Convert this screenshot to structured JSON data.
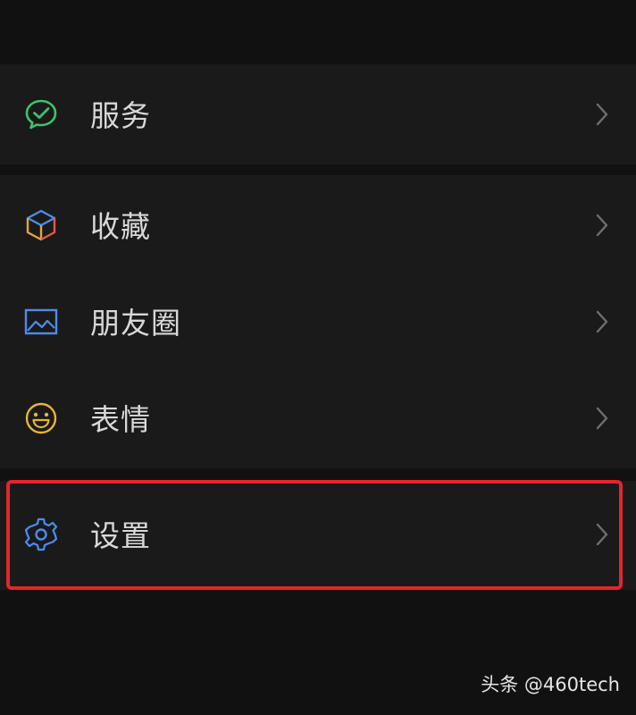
{
  "menu": {
    "items": [
      {
        "label": "服务",
        "icon": "wechat-pay-check-icon",
        "color": "#3cc46a"
      },
      {
        "label": "收藏",
        "icon": "cube-icon",
        "color": "#e8a33c"
      },
      {
        "label": "朋友圈",
        "icon": "image-landscape-icon",
        "color": "#4a8df0"
      },
      {
        "label": "表情",
        "icon": "smiley-face-icon",
        "color": "#e8b43a"
      },
      {
        "label": "设置",
        "icon": "gear-icon",
        "color": "#4a8df0"
      }
    ]
  },
  "highlight": {
    "target": "设置",
    "color": "#e2262b"
  },
  "watermark": {
    "text": "头条 @460tech"
  }
}
